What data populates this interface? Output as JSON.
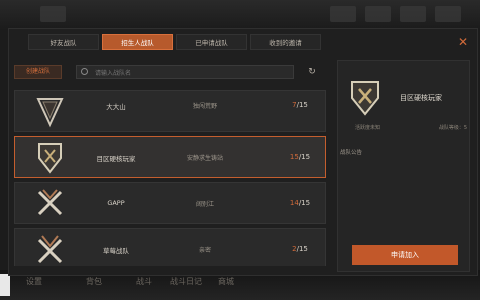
{
  "tabs": [
    {
      "label": "好友战队",
      "active": false
    },
    {
      "label": "招生人战队",
      "active": true
    },
    {
      "label": "已申请战队",
      "active": false
    },
    {
      "label": "收到的邀请",
      "active": false
    }
  ],
  "create_button": "创建战队",
  "search": {
    "placeholder": "请输入战队名"
  },
  "teams": [
    {
      "name": "大大山",
      "status": "独闯荒野",
      "current": "7",
      "max": "/15",
      "selected": false
    },
    {
      "name": "目区硬核玩家",
      "status": "安静求生铸站",
      "current": "15",
      "max": "/15",
      "selected": true
    },
    {
      "name": "GAPP",
      "status": "阔别江",
      "current": "14",
      "max": "/15",
      "selected": false
    },
    {
      "name": "草莓战队",
      "status": "亲密",
      "current": "2",
      "max": "/15",
      "selected": false
    }
  ],
  "detail": {
    "team_name": "目区硬核玩家",
    "meta_left": "活跃度未知",
    "meta_right": "战队等级：5",
    "section_label": "战队公告",
    "apply_button": "申请加入"
  },
  "bottom_bar": [
    "设置",
    "背包",
    "战斗",
    "战斗日记",
    "商城"
  ],
  "colors": {
    "accent": "#c2582a",
    "selected_border": "#c45e2e",
    "panel": "#1f1f1f"
  },
  "icons": [
    "close-icon",
    "search-icon",
    "refresh-icon",
    "team-emblem-icon"
  ]
}
